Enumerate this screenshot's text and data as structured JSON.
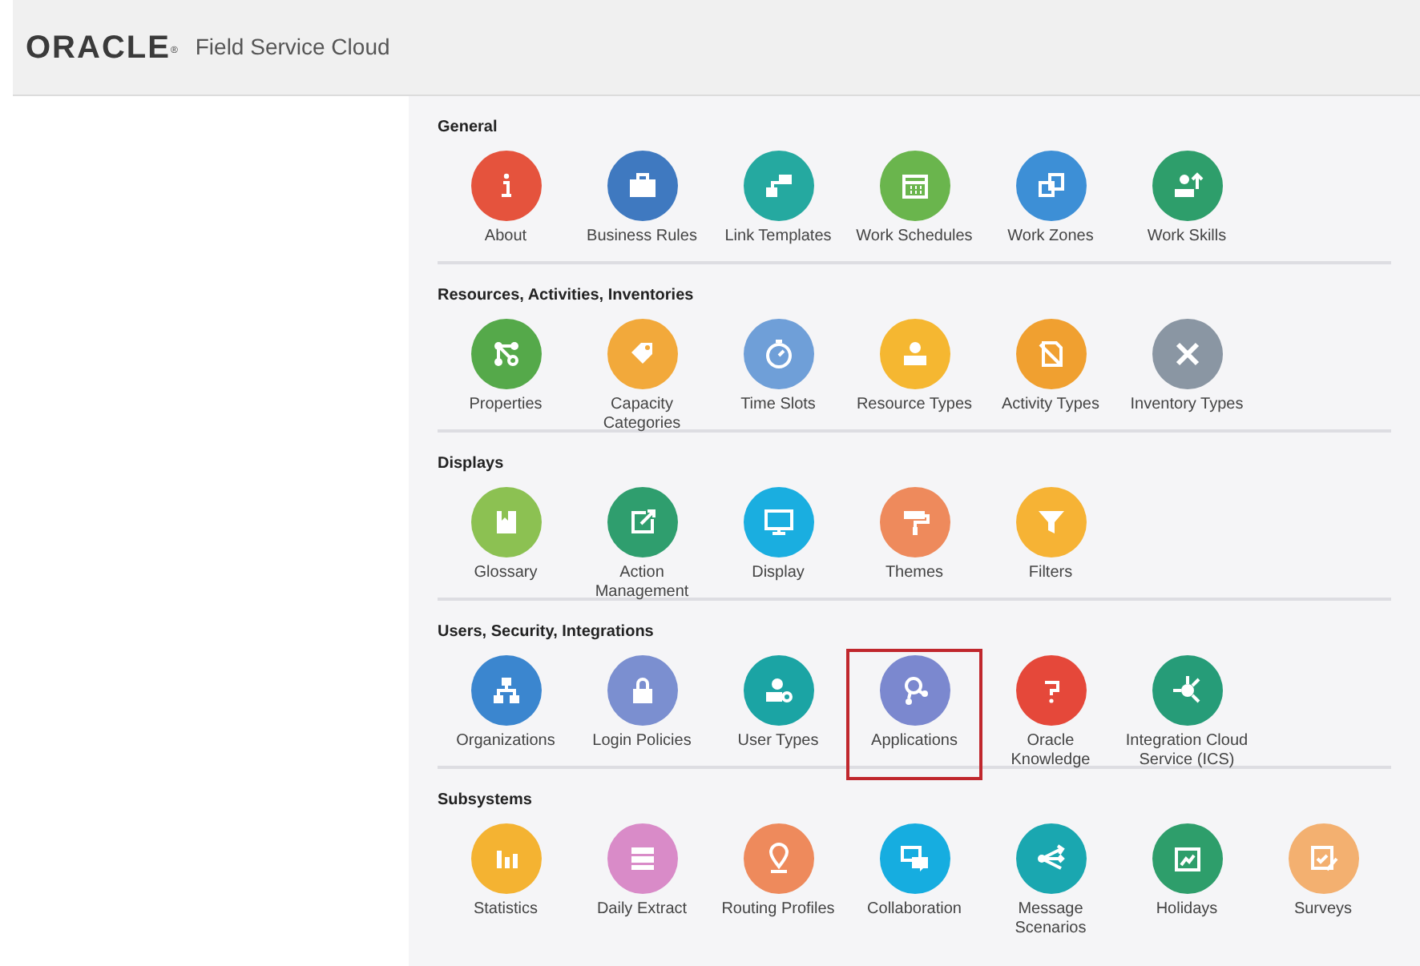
{
  "header": {
    "logo": "ORACLE",
    "logo_mark": "®",
    "product": "Field Service Cloud"
  },
  "sections": [
    {
      "title": "General",
      "items": [
        {
          "label": "About",
          "color": "#e5533d",
          "selected": false
        },
        {
          "label": "Business Rules",
          "color": "#3f79c0",
          "selected": false
        },
        {
          "label": "Link Templates",
          "color": "#25a9a0",
          "selected": false
        },
        {
          "label": "Work Schedules",
          "color": "#6ab54d",
          "selected": false
        },
        {
          "label": "Work Zones",
          "color": "#3d8fd6",
          "selected": false
        },
        {
          "label": "Work Skills",
          "color": "#2e9e6b",
          "selected": false
        }
      ]
    },
    {
      "title": "Resources, Activities, Inventories",
      "items": [
        {
          "label": "Properties",
          "color": "#55a94a",
          "selected": false
        },
        {
          "label": "Capacity Categories",
          "color": "#f2a93b",
          "selected": false
        },
        {
          "label": "Time Slots",
          "color": "#6f9fd8",
          "selected": false
        },
        {
          "label": "Resource Types",
          "color": "#f5b731",
          "selected": false
        },
        {
          "label": "Activity Types",
          "color": "#f0a030",
          "selected": false
        },
        {
          "label": "Inventory Types",
          "color": "#8a96a3",
          "selected": false
        }
      ]
    },
    {
      "title": "Displays",
      "items": [
        {
          "label": "Glossary",
          "color": "#8cc152",
          "selected": false
        },
        {
          "label": "Action Management",
          "color": "#2f9e6e",
          "selected": false
        },
        {
          "label": "Display",
          "color": "#1aaee0",
          "selected": false
        },
        {
          "label": "Themes",
          "color": "#ee8a5c",
          "selected": false
        },
        {
          "label": "Filters",
          "color": "#f6b335",
          "selected": false
        }
      ]
    },
    {
      "title": "Users, Security, Integrations",
      "items": [
        {
          "label": "Organizations",
          "color": "#3b86cf",
          "selected": false
        },
        {
          "label": "Login Policies",
          "color": "#7b8fd0",
          "selected": false
        },
        {
          "label": "User Types",
          "color": "#1ba4a4",
          "selected": false
        },
        {
          "label": "Applications",
          "color": "#7b88cf",
          "selected": true
        },
        {
          "label": "Oracle Knowledge",
          "color": "#e5483a",
          "selected": false
        },
        {
          "label": "Integration Cloud Service (ICS)",
          "color": "#269c78",
          "selected": false
        }
      ]
    },
    {
      "title": "Subsystems",
      "items": [
        {
          "label": "Statistics",
          "color": "#f4b332",
          "selected": false
        },
        {
          "label": "Daily Extract",
          "color": "#d98bc8",
          "selected": false
        },
        {
          "label": "Routing Profiles",
          "color": "#ee8a5c",
          "selected": false
        },
        {
          "label": "Collaboration",
          "color": "#16ade0",
          "selected": false
        },
        {
          "label": "Message Scenarios",
          "color": "#1aa7b0",
          "selected": false
        },
        {
          "label": "Holidays",
          "color": "#2e9e6b",
          "selected": false
        },
        {
          "label": "Surveys",
          "color": "#f3b070",
          "selected": false
        }
      ]
    }
  ]
}
